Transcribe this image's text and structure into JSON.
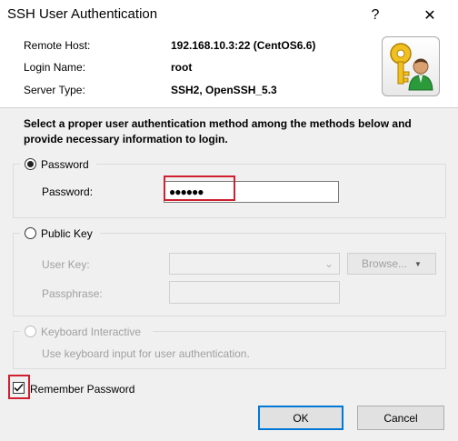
{
  "window": {
    "title": "SSH User Authentication",
    "help_glyph": "?",
    "close_glyph": "✕"
  },
  "header": {
    "remote_host_label": "Remote Host:",
    "remote_host_value": "192.168.10.3:22 (CentOS6.6)",
    "login_name_label": "Login Name:",
    "login_name_value": "root",
    "server_type_label": "Server Type:",
    "server_type_value": "SSH2, OpenSSH_5.3",
    "app_icon": "key-user-icon"
  },
  "instruction": "Select a proper user authentication method among the methods below and provide necessary information to login.",
  "password_group": {
    "radio_label": "Password",
    "selected": true,
    "field_label": "Password:",
    "field_value": "●●●●●●"
  },
  "public_key_group": {
    "radio_label": "Public Key",
    "user_key_label": "User Key:",
    "user_key_value": "",
    "browse_label": "Browse...",
    "passphrase_label": "Passphrase:",
    "passphrase_value": ""
  },
  "keyboard_group": {
    "radio_label": "Keyboard Interactive",
    "description": "Use keyboard input for user authentication."
  },
  "remember": {
    "label": "Remember Password",
    "checked": true
  },
  "buttons": {
    "ok": "OK",
    "cancel": "Cancel"
  },
  "colors": {
    "highlight": "#d02030",
    "accent": "#0078d7"
  }
}
